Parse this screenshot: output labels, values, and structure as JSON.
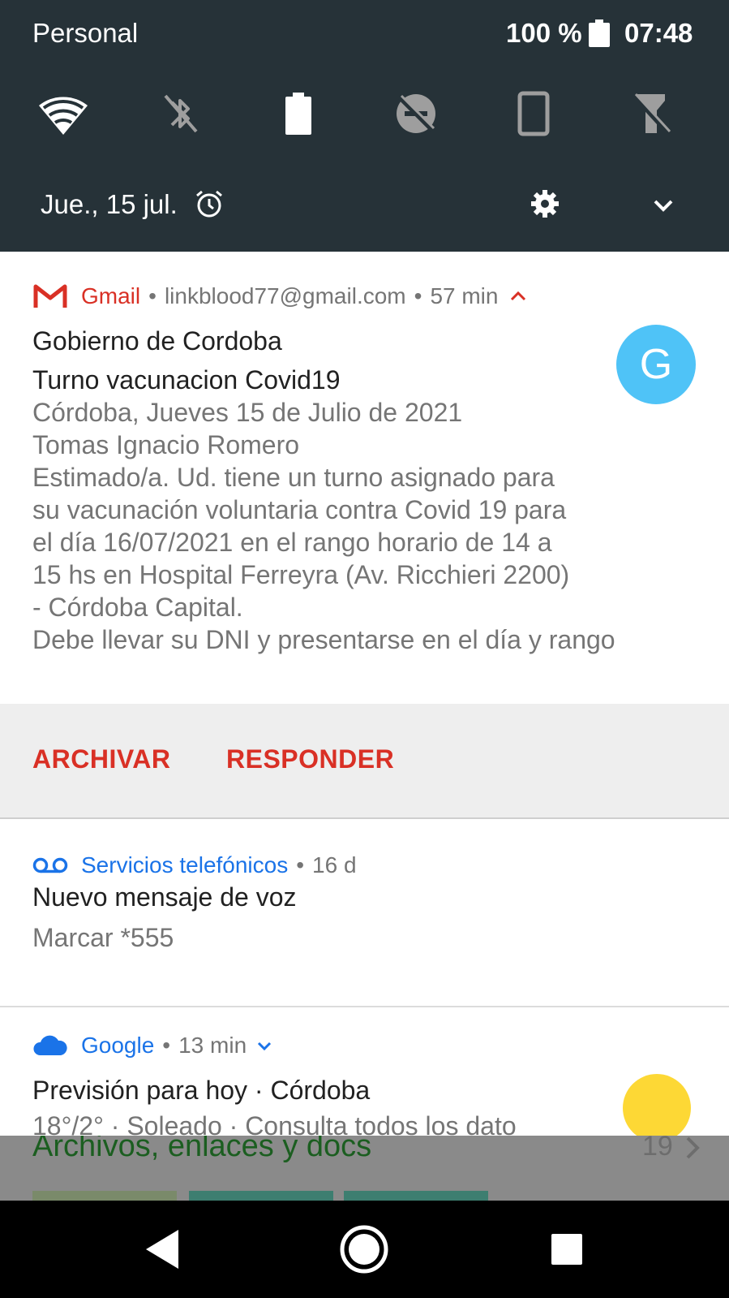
{
  "status_bar": {
    "carrier": "Personal",
    "battery_percent": "100 %",
    "time": "07:48"
  },
  "quick_settings": {
    "tiles": [
      {
        "name": "wifi-icon",
        "state": "on"
      },
      {
        "name": "bluetooth-off-icon",
        "state": "off"
      },
      {
        "name": "battery-saver-icon",
        "state": "on"
      },
      {
        "name": "data-saver-off-icon",
        "state": "off"
      },
      {
        "name": "auto-rotate-icon",
        "state": "on"
      },
      {
        "name": "flashlight-off-icon",
        "state": "off"
      }
    ],
    "date": "Jue., 15 jul."
  },
  "notifications": {
    "gmail": {
      "app": "Gmail",
      "account": "linkblood77@gmail.com",
      "time": "57 min",
      "sender": "Gobierno de Cordoba",
      "subject": "Turno vacunacion Covid19",
      "avatar_letter": "G",
      "body_lines": [
        "Córdoba, Jueves 15 de Julio de 2021",
        "Tomas Ignacio Romero",
        "Estimado/a. Ud. tiene un turno asignado para",
        "su vacunación voluntaria contra Covid 19 para",
        "el día 16/07/2021 en el rango horario de 14 a",
        "15 hs en Hospital Ferreyra (Av. Ricchieri 2200)",
        "- Córdoba Capital.",
        "Debe llevar su DNI y presentarse en el día y rango"
      ],
      "actions": {
        "archive": "ARCHIVAR",
        "reply": "RESPONDER"
      }
    },
    "voicemail": {
      "app": "Servicios telefónicos",
      "time": "16 d",
      "title": "Nuevo mensaje de voz",
      "body": "Marcar *555"
    },
    "weather": {
      "app": "Google",
      "time": "13 min",
      "title": "Previsión para hoy · Córdoba",
      "body": "18°/2° · Soleado · Consulta todos los dato"
    }
  },
  "background_app": {
    "section_title": "Archivos, enlaces y docs",
    "count": "19"
  },
  "colors": {
    "shade_bg": "#263238",
    "gmail_red": "#d93025",
    "google_blue": "#1a73e8",
    "avatar_bg": "#4fc3f7",
    "sun": "#fdd835"
  }
}
